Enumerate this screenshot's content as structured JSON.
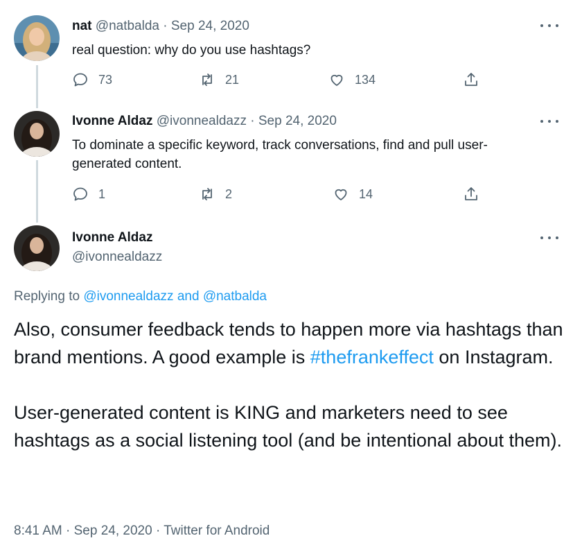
{
  "tweet1": {
    "name": "nat",
    "handle": "@natbalda",
    "sep": "·",
    "date": "Sep 24, 2020",
    "text": "real question: why do you use hashtags?",
    "replies": "73",
    "retweets": "21",
    "likes": "134"
  },
  "tweet2": {
    "name": "Ivonne Aldaz",
    "handle": "@ivonnealdazz",
    "sep": "·",
    "date": "Sep 24, 2020",
    "text": "To dominate a specific keyword, track conversations, find and pull user-generated content.",
    "replies": "1",
    "retweets": "2",
    "likes": "14"
  },
  "main": {
    "name": "Ivonne Aldaz",
    "handle": "@ivonnealdazz",
    "replying_prefix": "Replying to",
    "reply_to_1": "@ivonnealdazz",
    "reply_and": "and",
    "reply_to_2": "@natbalda",
    "p1_a": "Also, consumer feedback tends to happen more via hashtags than brand mentions. A good example is ",
    "hashtag": "#thefrankeffect",
    "p1_b": " on Instagram.",
    "p2": "User-generated content is KING and marketers need to see hashtags as a social listening tool (and be intentional about them).",
    "time": "8:41 AM",
    "sep": "·",
    "date": "Sep 24, 2020",
    "source": "Twitter for Android"
  },
  "colors": {
    "link": "#1d9bf0",
    "meta": "#536471",
    "text": "#0f1419",
    "thread_line": "#cfd9de"
  }
}
